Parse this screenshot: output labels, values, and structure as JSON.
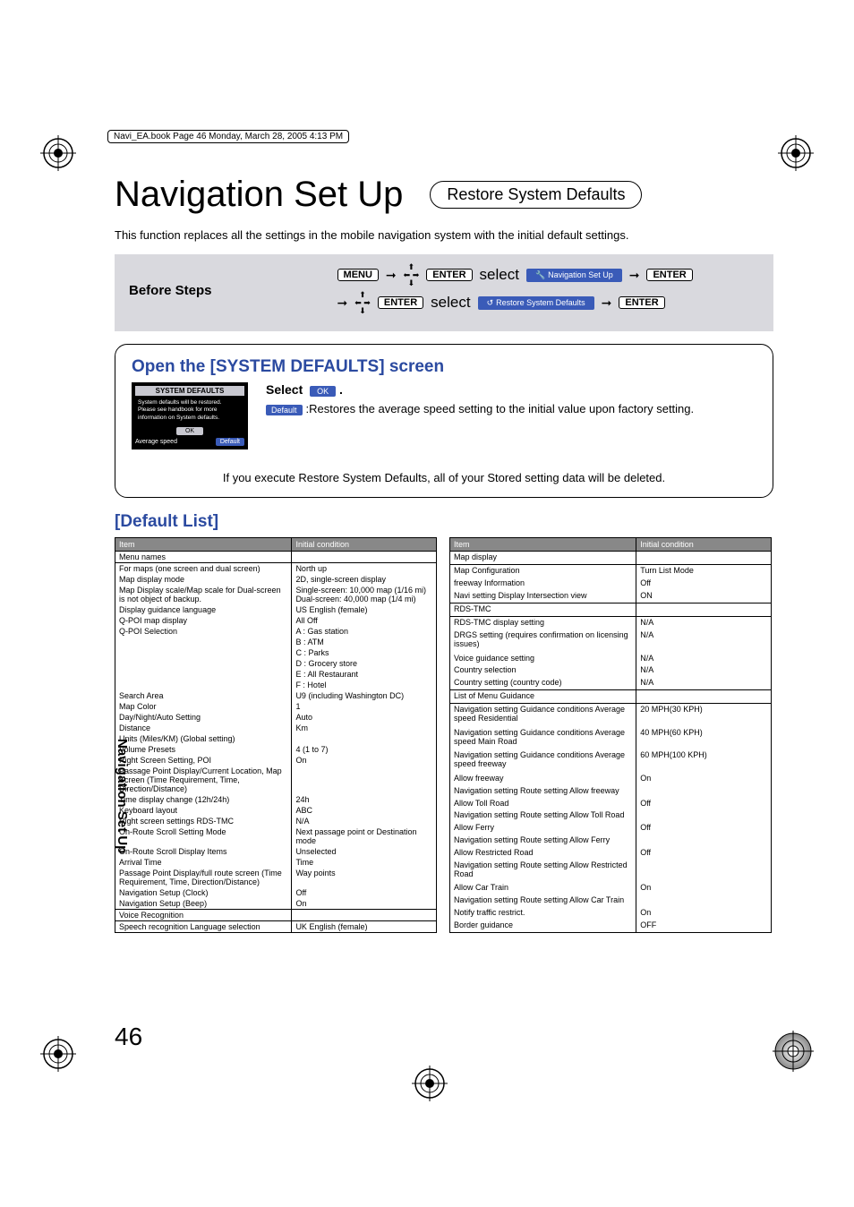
{
  "header_info": "Navi_EA.book  Page 46  Monday, March 28, 2005  4:13 PM",
  "main_title": "Navigation Set Up",
  "sub_title": "Restore System Defaults",
  "intro": "This function replaces all the settings in the mobile navigation system with the initial default settings.",
  "before_steps": {
    "label": "Before Steps",
    "menu": "MENU",
    "enter": "ENTER",
    "select": "select",
    "nav_setup": "Navigation Set Up",
    "restore": "Restore System Defaults"
  },
  "open_box": {
    "title": "Open the [SYSTEM DEFAULTS] screen",
    "screen_header": "SYSTEM DEFAULTS",
    "screen_body1": "System defaults will be restored.",
    "screen_body2": "Please see handbook for more",
    "screen_body3": "information on System defaults.",
    "ok": "OK",
    "average_speed": "Average speed",
    "default_btn": "Default",
    "select_label": "Select",
    "ok_chip": "OK",
    "default_chip": "Default",
    "restore_txt": ":Restores the average speed setting to the initial value upon factory setting.",
    "warn": "If you execute Restore System Defaults, all of your Stored setting data will be deleted."
  },
  "default_list_title": "[Default List]",
  "table1": {
    "h1": "Item",
    "h2": "Initial condition",
    "rows": [
      {
        "sep": true,
        "c1": "Menu names",
        "c2": ""
      },
      {
        "sep": true,
        "c1": "For maps (one screen and dual screen)",
        "c2": "North up"
      },
      {
        "c1": "Map display mode",
        "c2": "2D, single-screen display"
      },
      {
        "c1": "Map Display scale/Map scale for Dual-screen is not object of backup.",
        "c2": "Single-screen: 10,000 map (1/16 mi) Dual-screen: 40,000 map (1/4 mi)"
      },
      {
        "c1": "Display guidance language",
        "c2": "US English (female)"
      },
      {
        "c1": "Q-POI map display",
        "c2": "All Off"
      },
      {
        "c1": "Q-POI Selection",
        "c2": "A : Gas station"
      },
      {
        "c1": "",
        "c2": "B : ATM"
      },
      {
        "c1": "",
        "c2": "C : Parks"
      },
      {
        "c1": "",
        "c2": "D : Grocery store"
      },
      {
        "c1": "",
        "c2": "E : All Restaurant"
      },
      {
        "c1": "",
        "c2": "F : Hotel"
      },
      {
        "c1": "Search Area",
        "c2": "U9 (including Washington DC)"
      },
      {
        "c1": "Map Color",
        "c2": "1"
      },
      {
        "c1": "Day/Night/Auto Setting",
        "c2": "Auto"
      },
      {
        "c1": "Distance",
        "c2": "Km"
      },
      {
        "c1": "Units (Miles/KM) (Global setting)",
        "c2": ""
      },
      {
        "c1": "Volume Presets",
        "c2": "4 (1 to 7)"
      },
      {
        "c1": "Right Screen Setting, POI",
        "c2": "On"
      },
      {
        "c1": "Passage Point Display/Current Location, Map Screen (Time Requirement, Time, Direction/Distance)",
        "c2": ""
      },
      {
        "c1": "Time display change (12h/24h)",
        "c2": "24h"
      },
      {
        "c1": "Keyboard layout",
        "c2": "ABC"
      },
      {
        "c1": "Right screen settings RDS-TMC",
        "c2": "N/A"
      },
      {
        "c1": "On-Route Scroll Setting Mode",
        "c2": "Next passage point or Destination mode"
      },
      {
        "c1": "On-Route Scroll Display Items",
        "c2": "Unselected"
      },
      {
        "c1": "Arrival Time",
        "c2": "Time"
      },
      {
        "c1": "Passage Point Display/full route screen (Time Requirement, Time, Direction/Distance)",
        "c2": "Way points"
      },
      {
        "c1": "Navigation Setup (Clock)",
        "c2": "Off"
      },
      {
        "c1": "Navigation Setup (Beep)",
        "c2": "On"
      },
      {
        "sep": true,
        "c1": "Voice Recognition",
        "c2": ""
      },
      {
        "sep": true,
        "c1": "Speech recognition Language selection",
        "c2": "UK English (female)"
      }
    ]
  },
  "table2": {
    "h1": "Item",
    "h2": "Initial condition",
    "rows": [
      {
        "sep": true,
        "c1": "Map display",
        "c2": ""
      },
      {
        "sep": true,
        "c1": "Map Configuration",
        "c2": "Turn List Mode"
      },
      {
        "c1": "freeway Information",
        "c2": "Off"
      },
      {
        "c1": "Navi setting Display Intersection view",
        "c2": "ON"
      },
      {
        "sep": true,
        "c1": "RDS-TMC",
        "c2": ""
      },
      {
        "sep": true,
        "c1": "RDS-TMC display setting",
        "c2": "N/A"
      },
      {
        "c1": "DRGS setting (requires confirmation on licensing issues)",
        "c2": "N/A"
      },
      {
        "c1": "Voice guidance setting",
        "c2": "N/A"
      },
      {
        "c1": "Country selection",
        "c2": "N/A"
      },
      {
        "c1": "Country setting (country code)",
        "c2": "N/A"
      },
      {
        "sep": true,
        "c1": "List of Menu Guidance",
        "c2": ""
      },
      {
        "sep": true,
        "c1": "Navigation setting Guidance conditions Average speed Residential",
        "c2": "20 MPH(30 KPH)"
      },
      {
        "c1": "Navigation setting Guidance conditions Average speed Main Road",
        "c2": "40 MPH(60 KPH)"
      },
      {
        "c1": "Navigation setting Guidance conditions Average speed freeway",
        "c2": "60 MPH(100 KPH)"
      },
      {
        "c1": "Allow freeway",
        "c2": "On"
      },
      {
        "c1": "Navigation setting Route setting Allow freeway",
        "c2": ""
      },
      {
        "c1": "Allow Toll Road",
        "c2": "Off"
      },
      {
        "c1": "Navigation setting Route setting Allow Toll Road",
        "c2": ""
      },
      {
        "c1": "Allow Ferry",
        "c2": "Off"
      },
      {
        "c1": "Navigation setting Route setting Allow Ferry",
        "c2": ""
      },
      {
        "c1": "Allow Restricted Road",
        "c2": "Off"
      },
      {
        "c1": "Navigation setting Route setting Allow Restricted Road",
        "c2": ""
      },
      {
        "c1": "Allow Car Train",
        "c2": "On"
      },
      {
        "c1": "Navigation setting Route setting Allow Car Train",
        "c2": ""
      },
      {
        "c1": "Notify traffic restrict.",
        "c2": "On"
      },
      {
        "c1": "Border guidance",
        "c2": "OFF"
      }
    ]
  },
  "side_tab": "Navigation Set Up",
  "page_num": "46"
}
